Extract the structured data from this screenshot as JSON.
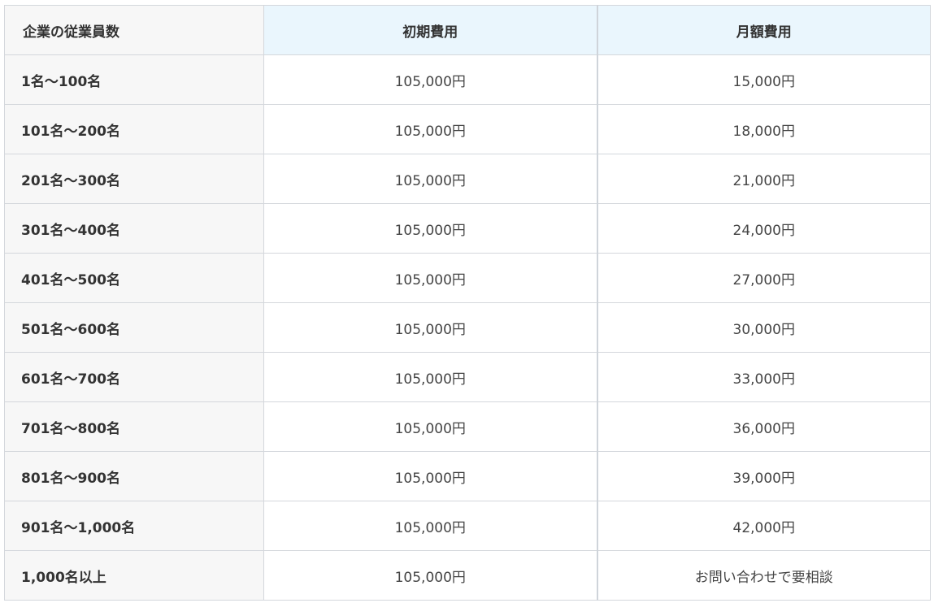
{
  "table": {
    "headers": {
      "employees": "企業の従業員数",
      "initial_fee": "初期費用",
      "monthly_fee": "月額費用"
    },
    "rows": [
      {
        "employees": "1名〜100名",
        "initial_fee": "105,000円",
        "monthly_fee": "15,000円"
      },
      {
        "employees": "101名〜200名",
        "initial_fee": "105,000円",
        "monthly_fee": "18,000円"
      },
      {
        "employees": "201名〜300名",
        "initial_fee": "105,000円",
        "monthly_fee": "21,000円"
      },
      {
        "employees": "301名〜400名",
        "initial_fee": "105,000円",
        "monthly_fee": "24,000円"
      },
      {
        "employees": "401名〜500名",
        "initial_fee": "105,000円",
        "monthly_fee": "27,000円"
      },
      {
        "employees": "501名〜600名",
        "initial_fee": "105,000円",
        "monthly_fee": "30,000円"
      },
      {
        "employees": "601名〜700名",
        "initial_fee": "105,000円",
        "monthly_fee": "33,000円"
      },
      {
        "employees": "701名〜800名",
        "initial_fee": "105,000円",
        "monthly_fee": "36,000円"
      },
      {
        "employees": "801名〜900名",
        "initial_fee": "105,000円",
        "monthly_fee": "39,000円"
      },
      {
        "employees": "901名〜1,000名",
        "initial_fee": "105,000円",
        "monthly_fee": "42,000円"
      },
      {
        "employees": "1,000名以上",
        "initial_fee": "105,000円",
        "monthly_fee": "お問い合わせで要相談"
      }
    ]
  },
  "colors": {
    "header_highlight": "#eaf6fd",
    "label_background": "#f7f7f7",
    "border": "#d4d7dc"
  }
}
